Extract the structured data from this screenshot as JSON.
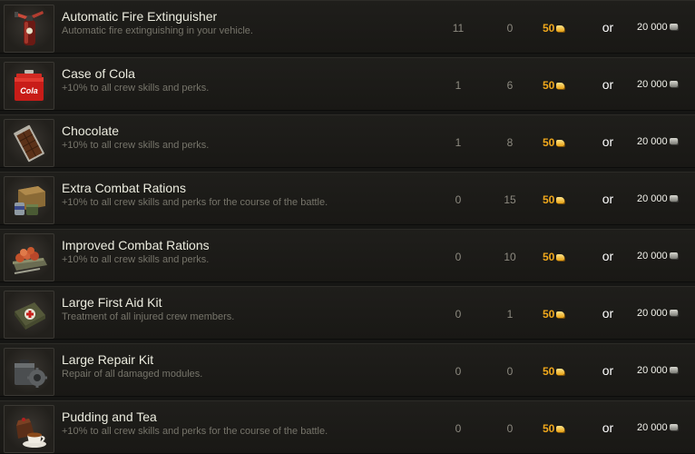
{
  "or_label": "or",
  "items": [
    {
      "icon": "fire-extinguisher-icon",
      "name": "Automatic Fire Extinguisher",
      "description": "Automatic fire extinguishing in your vehicle.",
      "stock": "11",
      "owned": "0",
      "gold_price": "50",
      "credit_price": "20 000"
    },
    {
      "icon": "cola-case-icon",
      "name": "Case of Cola",
      "description": "+10% to all crew skills and perks.",
      "stock": "1",
      "owned": "6",
      "gold_price": "50",
      "credit_price": "20 000",
      "icon_text": "Cola"
    },
    {
      "icon": "chocolate-icon",
      "name": "Chocolate",
      "description": "+10% to all crew skills and perks.",
      "stock": "1",
      "owned": "8",
      "gold_price": "50",
      "credit_price": "20 000"
    },
    {
      "icon": "combat-rations-icon",
      "name": "Extra Combat Rations",
      "description": "+10% to all crew skills and perks for the course of the battle.",
      "stock": "0",
      "owned": "15",
      "gold_price": "50",
      "credit_price": "20 000"
    },
    {
      "icon": "improved-rations-icon",
      "name": "Improved Combat Rations",
      "description": "+10% to all crew skills and perks.",
      "stock": "0",
      "owned": "10",
      "gold_price": "50",
      "credit_price": "20 000"
    },
    {
      "icon": "first-aid-kit-icon",
      "name": "Large First Aid Kit",
      "description": "Treatment of all injured crew members.",
      "stock": "0",
      "owned": "1",
      "gold_price": "50",
      "credit_price": "20 000"
    },
    {
      "icon": "repair-kit-icon",
      "name": "Large Repair Kit",
      "description": "Repair of all damaged modules.",
      "stock": "0",
      "owned": "0",
      "gold_price": "50",
      "credit_price": "20 000"
    },
    {
      "icon": "pudding-tea-icon",
      "name": "Pudding and Tea",
      "description": "+10% to all crew skills and perks for the course of the battle.",
      "stock": "0",
      "owned": "0",
      "gold_price": "50",
      "credit_price": "20 000"
    }
  ]
}
